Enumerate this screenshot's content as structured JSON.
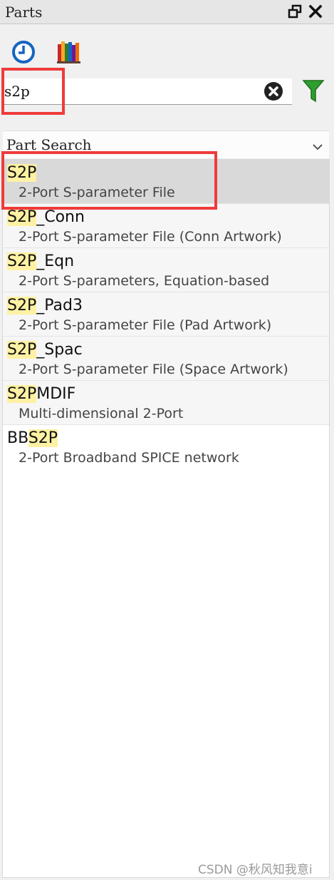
{
  "panel": {
    "title": "Parts",
    "float_icon": "float-window-icon",
    "close_icon": "close-icon"
  },
  "toolbar": {
    "history_icon": "history-icon",
    "library_icon": "library-books-icon"
  },
  "search": {
    "value": "s2p",
    "clear_icon": "clear-circle-icon",
    "filter_icon": "filter-funnel-icon"
  },
  "mode": {
    "selected": "Part Search",
    "chevron_icon": "chevron-down-icon"
  },
  "results": [
    {
      "prefix": "",
      "match": "S2P",
      "suffix": "",
      "description": "2-Port S-parameter File",
      "selected": true
    },
    {
      "prefix": "",
      "match": "S2P",
      "suffix": "_Conn",
      "description": "2-Port S-parameter File (Conn Artwork)",
      "selected": false
    },
    {
      "prefix": "",
      "match": "S2P",
      "suffix": "_Eqn",
      "description": "2-Port S-parameters, Equation-based",
      "selected": false
    },
    {
      "prefix": "",
      "match": "S2P",
      "suffix": "_Pad3",
      "description": "2-Port S-parameter File (Pad Artwork)",
      "selected": false
    },
    {
      "prefix": "",
      "match": "S2P",
      "suffix": "_Spac",
      "description": "2-Port S-parameter File (Space Artwork)",
      "selected": false
    },
    {
      "prefix": "",
      "match": "S2P",
      "suffix": "MDIF",
      "description": "Multi-dimensional 2-Port",
      "selected": false
    },
    {
      "prefix": "BB",
      "match": "S2P",
      "suffix": "",
      "description": "2-Port Broadband SPICE network",
      "selected": false
    }
  ],
  "watermark": "CSDN @秋风知我意i",
  "colors": {
    "highlight_box": "#ef3b3b",
    "match_highlight": "#fff1a3",
    "selected_row": "#d9d9d9",
    "filter_green": "#2e9e2e",
    "history_blue": "#1565c0"
  }
}
